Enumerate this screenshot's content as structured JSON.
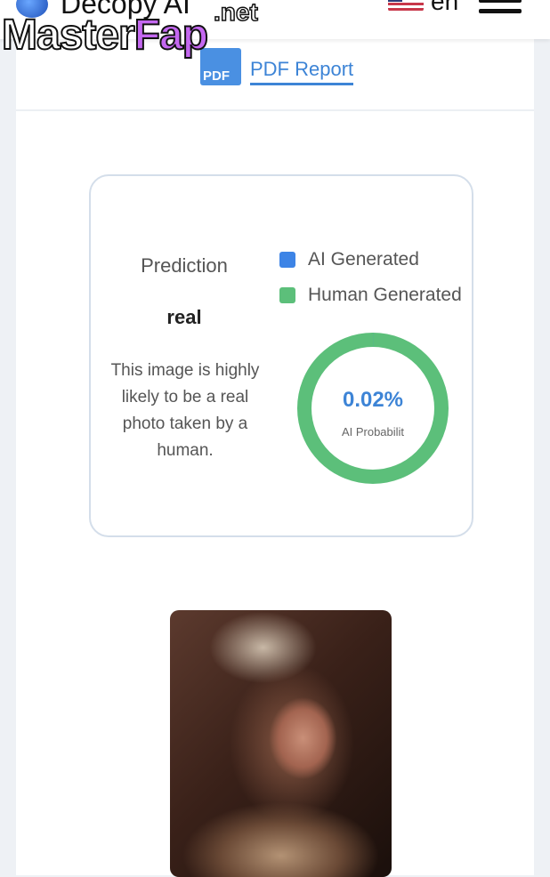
{
  "header": {
    "app_name": "Decopy AI",
    "language": "en"
  },
  "watermark": {
    "text_main": "Master",
    "text_accent": "Fap",
    "suffix": ".net"
  },
  "report": {
    "pdf_icon_text": "PDF",
    "link_label": "PDF Report"
  },
  "prediction": {
    "title": "Prediction",
    "value": "real",
    "description": "This image is highly likely to be a real photo taken by a human."
  },
  "legend": [
    {
      "label": "AI Generated",
      "color": "#3d84e6"
    },
    {
      "label": "Human Generated",
      "color": "#5cbf7a"
    }
  ],
  "donut": {
    "value_text": "0.02%",
    "label": "AI Probabilit",
    "ai_fraction": 0.0002,
    "ring_color": "#5cbf7a",
    "ai_color": "#3d84e6"
  },
  "colors": {
    "accent": "#3d84d6",
    "page_background": "#eef1f5"
  }
}
